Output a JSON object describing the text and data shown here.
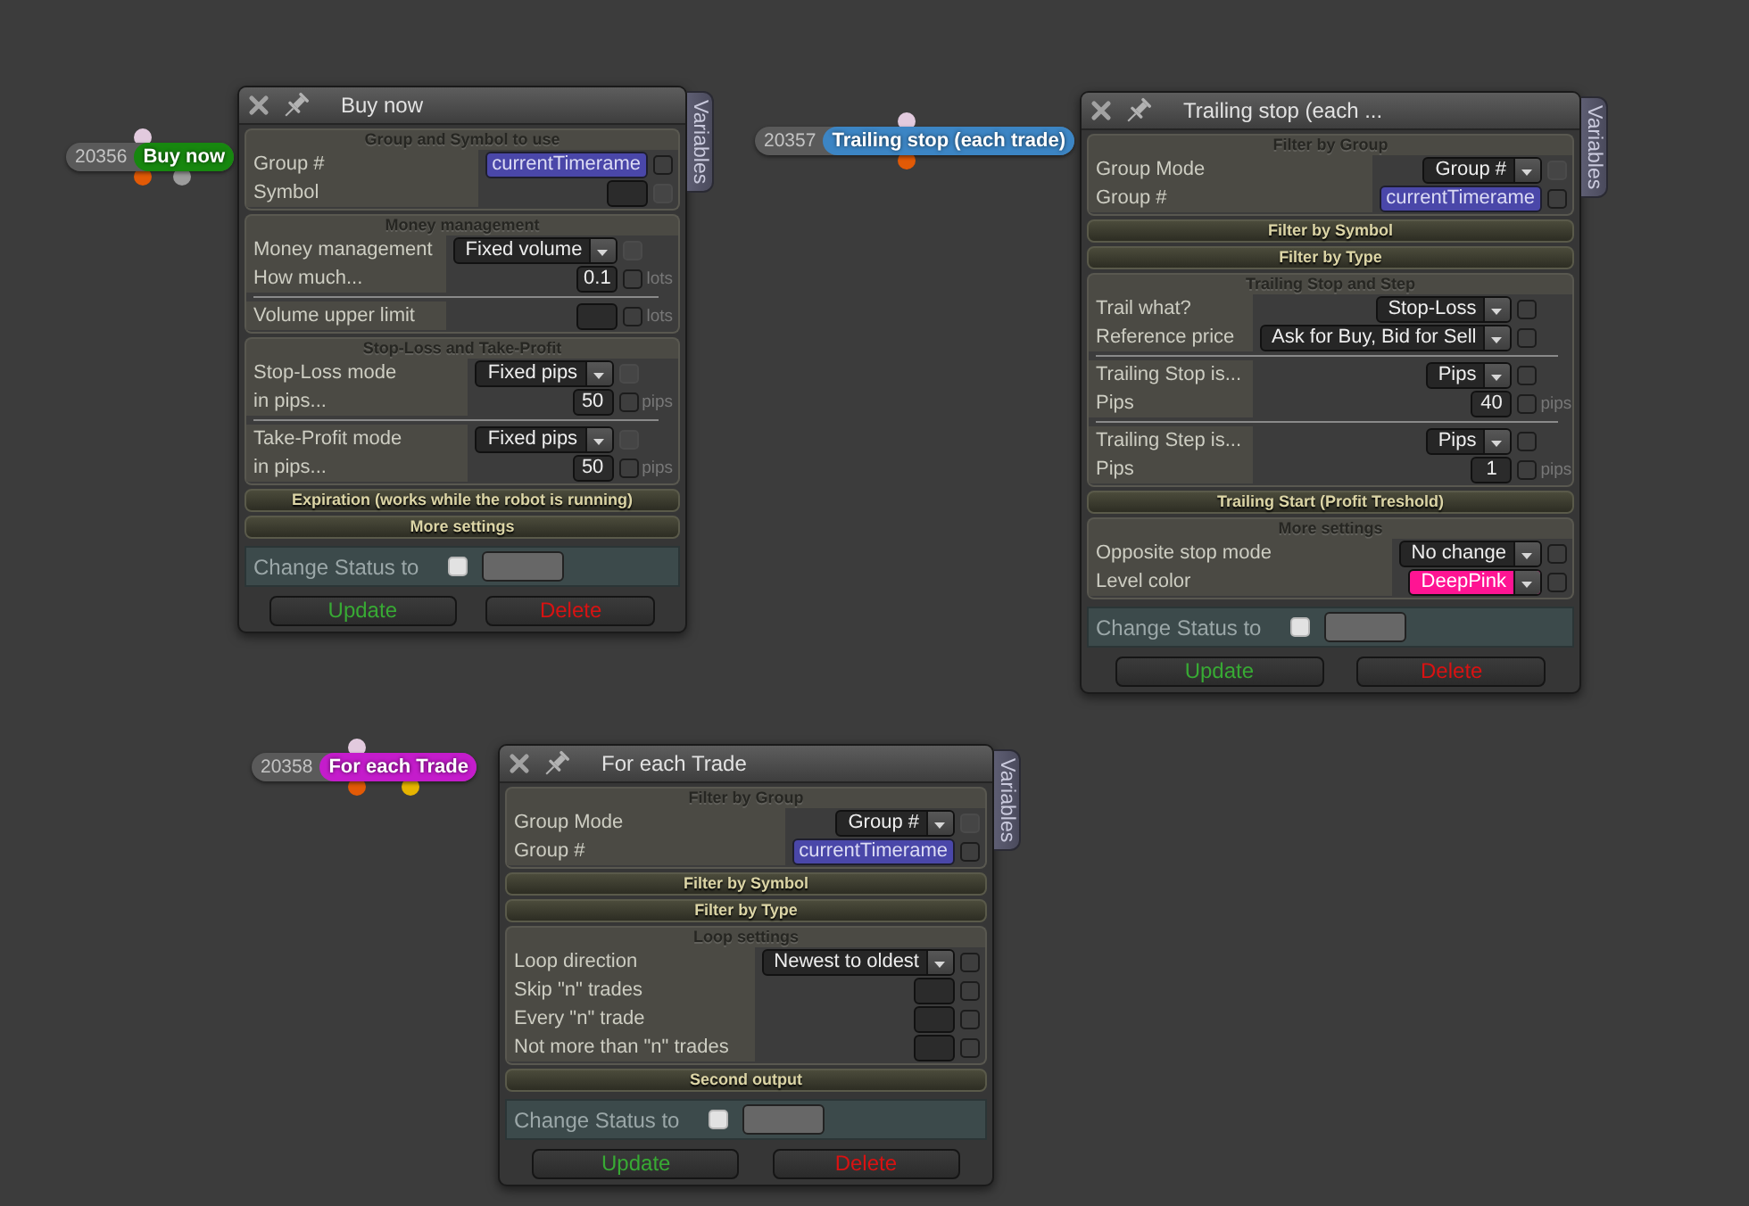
{
  "nodes": [
    {
      "number": "20356",
      "label": "Buy now",
      "color": "#17870f",
      "inputs": [
        {
          "color": "#e2cade"
        }
      ],
      "outputs": [
        {
          "color": "#e25a06"
        },
        {
          "color": "#9c9c9c"
        }
      ]
    },
    {
      "number": "20357",
      "label": "Trailing stop (each trade)",
      "color": "#3c85c4",
      "inputs": [
        {
          "color": "#e2cade"
        }
      ],
      "outputs": [
        {
          "color": "#e25a06"
        }
      ]
    },
    {
      "number": "20358",
      "label": "For each Trade",
      "color": "#c41ccb",
      "inputs": [
        {
          "color": "#e2cade"
        }
      ],
      "outputs": [
        {
          "color": "#e25a06"
        },
        {
          "color": "#e6b400"
        }
      ]
    }
  ],
  "panels": [
    {
      "title": "Buy now",
      "side_tab": "Variables",
      "sections": [
        {
          "title": "Group and Symbol to use",
          "expanded": true,
          "groups": [
            {
              "rows": [
                {
                  "label": "Group #",
                  "kind": "variable",
                  "value": "currentTimerame",
                  "checkbox": {
                    "checked": false,
                    "disabled": false
                  }
                },
                {
                  "label": "Symbol",
                  "kind": "field",
                  "checkbox": {
                    "checked": false,
                    "disabled": true
                  }
                }
              ]
            }
          ]
        },
        {
          "title": "Money management",
          "expanded": true,
          "groups": [
            {
              "rows": [
                {
                  "label": "Money management",
                  "kind": "dropdown",
                  "value": "Fixed volume",
                  "checkbox": {
                    "checked": false,
                    "disabled": true
                  }
                },
                {
                  "label": "How much...",
                  "kind": "field",
                  "value": "0.1",
                  "unit": "lots",
                  "checkbox": {
                    "checked": false,
                    "disabled": false
                  }
                }
              ]
            },
            {
              "rows": [
                {
                  "label": "Volume upper limit",
                  "kind": "field",
                  "unit": "lots",
                  "checkbox": {
                    "checked": false,
                    "disabled": false
                  }
                }
              ]
            }
          ]
        },
        {
          "title": "Stop-Loss and Take-Profit",
          "expanded": true,
          "groups": [
            {
              "rows": [
                {
                  "label": "Stop-Loss mode",
                  "kind": "dropdown",
                  "value": "Fixed pips",
                  "checkbox": {
                    "checked": false,
                    "disabled": true
                  }
                },
                {
                  "label": "in pips...",
                  "kind": "field",
                  "value": "50",
                  "unit": "pips",
                  "checkbox": {
                    "checked": false,
                    "disabled": false
                  }
                }
              ]
            },
            {
              "rows": [
                {
                  "label": "Take-Profit mode",
                  "kind": "dropdown",
                  "value": "Fixed pips",
                  "checkbox": {
                    "checked": false,
                    "disabled": true
                  }
                },
                {
                  "label": "in pips...",
                  "kind": "field",
                  "value": "50",
                  "unit": "pips",
                  "checkbox": {
                    "checked": false,
                    "disabled": false
                  }
                }
              ]
            }
          ]
        },
        {
          "title": "Expiration (works while the robot is running)",
          "expanded": false
        },
        {
          "title": "More settings",
          "expanded": false
        }
      ],
      "status": {
        "label": "Change Status to",
        "checked": false
      },
      "buttons": [
        {
          "label": "Update",
          "kind": "update"
        },
        {
          "label": "Delete",
          "kind": "delete"
        }
      ]
    },
    {
      "title": "Trailing stop (each ...",
      "side_tab": "Variables",
      "sections": [
        {
          "title": "Filter by Group",
          "expanded": true,
          "groups": [
            {
              "rows": [
                {
                  "label": "Group Mode",
                  "kind": "dropdown",
                  "value": "Group #",
                  "checkbox": {
                    "checked": false,
                    "disabled": true
                  }
                },
                {
                  "label": "Group #",
                  "kind": "variable",
                  "value": "currentTimerame",
                  "checkbox": {
                    "checked": false,
                    "disabled": false
                  }
                }
              ]
            }
          ]
        },
        {
          "title": "Filter by Symbol",
          "expanded": false
        },
        {
          "title": "Filter by Type",
          "expanded": false
        },
        {
          "title": "Trailing Stop and Step",
          "expanded": true,
          "groups": [
            {
              "rows": [
                {
                  "label": "Trail what?",
                  "kind": "dropdown",
                  "value": "Stop-Loss",
                  "checkbox": {
                    "checked": false,
                    "disabled": false
                  }
                },
                {
                  "label": "Reference price",
                  "kind": "dropdown",
                  "value": "Ask for Buy, Bid for Sell",
                  "checkbox": {
                    "checked": false,
                    "disabled": false
                  }
                }
              ]
            },
            {
              "rows": [
                {
                  "label": "Trailing Stop is...",
                  "kind": "dropdown",
                  "value": "Pips",
                  "checkbox": {
                    "checked": false,
                    "disabled": false
                  }
                },
                {
                  "label": "Pips",
                  "kind": "field",
                  "value": "40",
                  "unit": "pips",
                  "checkbox": {
                    "checked": false,
                    "disabled": false
                  }
                }
              ]
            },
            {
              "rows": [
                {
                  "label": "Trailing Step is...",
                  "kind": "dropdown",
                  "value": "Pips",
                  "checkbox": {
                    "checked": false,
                    "disabled": false
                  }
                },
                {
                  "label": "Pips",
                  "kind": "field",
                  "value": "1",
                  "unit": "pips",
                  "checkbox": {
                    "checked": false,
                    "disabled": false
                  }
                }
              ]
            }
          ]
        },
        {
          "title": "Trailing Start (Profit Treshold)",
          "expanded": false
        },
        {
          "title": "More settings",
          "expanded": true,
          "groups": [
            {
              "rows": [
                {
                  "label": "Opposite stop mode",
                  "kind": "dropdown",
                  "value": "No change",
                  "checkbox": {
                    "checked": false,
                    "disabled": false
                  }
                },
                {
                  "label": "Level color",
                  "kind": "dropdown",
                  "value": "DeepPink",
                  "color": "#ff1493",
                  "checkbox": {
                    "checked": false,
                    "disabled": false
                  }
                }
              ]
            }
          ]
        }
      ],
      "status": {
        "label": "Change Status to",
        "checked": false
      },
      "buttons": [
        {
          "label": "Update",
          "kind": "update"
        },
        {
          "label": "Delete",
          "kind": "delete"
        }
      ]
    },
    {
      "title": "For each Trade",
      "side_tab": "Variables",
      "sections": [
        {
          "title": "Filter by Group",
          "expanded": true,
          "groups": [
            {
              "rows": [
                {
                  "label": "Group Mode",
                  "kind": "dropdown",
                  "value": "Group #",
                  "checkbox": {
                    "checked": false,
                    "disabled": true
                  }
                },
                {
                  "label": "Group #",
                  "kind": "variable",
                  "value": "currentTimerame",
                  "checkbox": {
                    "checked": false,
                    "disabled": false
                  }
                }
              ]
            }
          ]
        },
        {
          "title": "Filter by Symbol",
          "expanded": false
        },
        {
          "title": "Filter by Type",
          "expanded": false
        },
        {
          "title": "Loop settings",
          "expanded": true,
          "groups": [
            {
              "rows": [
                {
                  "label": "Loop direction",
                  "kind": "dropdown",
                  "value": "Newest to oldest",
                  "checkbox": {
                    "checked": false,
                    "disabled": false
                  }
                },
                {
                  "label": "Skip \"n\" trades",
                  "kind": "field",
                  "checkbox": {
                    "checked": false,
                    "disabled": false
                  }
                },
                {
                  "label": "Every \"n\" trade",
                  "kind": "field",
                  "checkbox": {
                    "checked": false,
                    "disabled": false
                  }
                },
                {
                  "label": "Not more than \"n\" trades",
                  "kind": "field",
                  "checkbox": {
                    "checked": false,
                    "disabled": false
                  }
                }
              ]
            }
          ]
        },
        {
          "title": "Second output",
          "expanded": false
        }
      ],
      "status": {
        "label": "Change Status to",
        "checked": false
      },
      "buttons": [
        {
          "label": "Update",
          "kind": "update"
        },
        {
          "label": "Delete",
          "kind": "delete"
        }
      ]
    }
  ]
}
